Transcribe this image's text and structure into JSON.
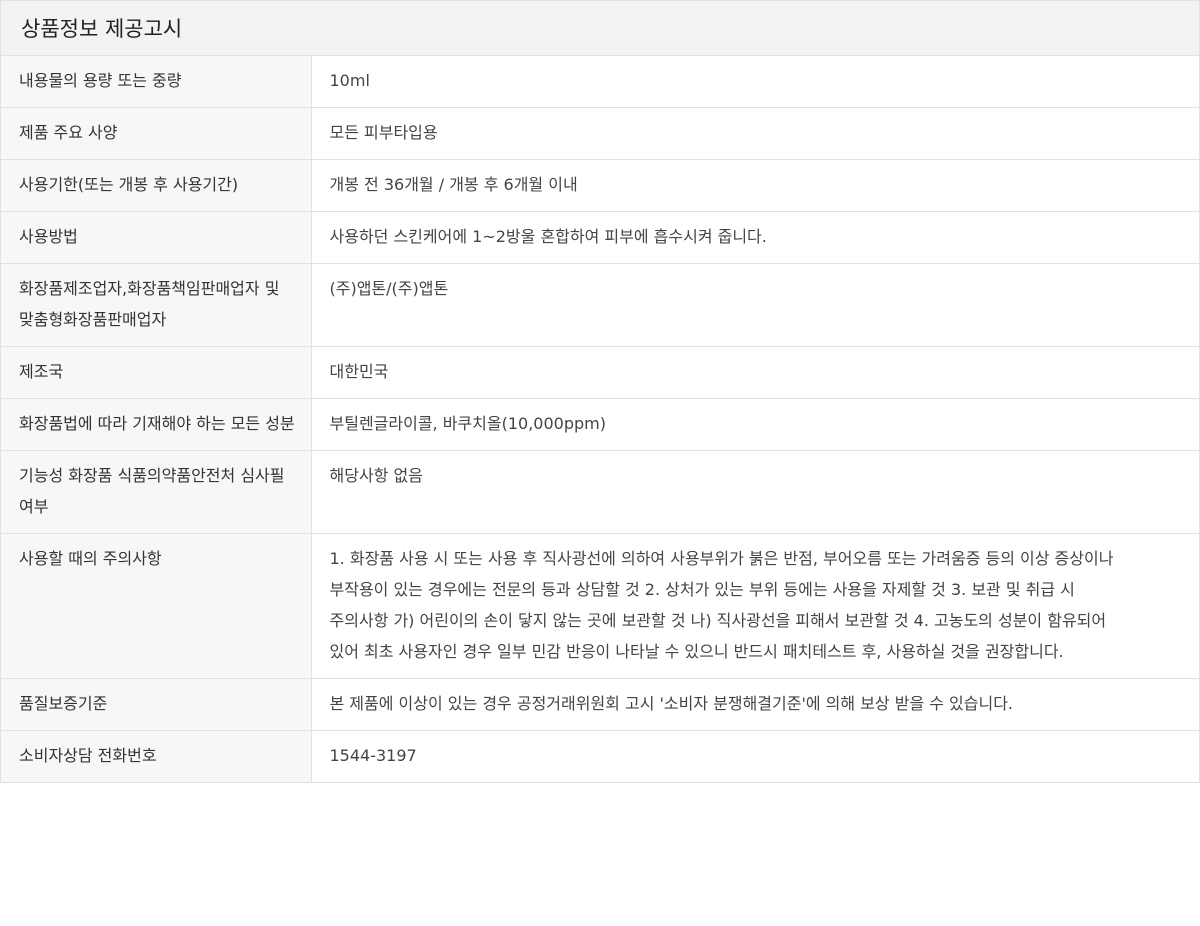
{
  "title": "상품정보 제공고시",
  "rows": [
    {
      "label": "내용물의 용량 또는 중량",
      "value": "10ml"
    },
    {
      "label": "제품 주요 사양",
      "value": "모든 피부타입용"
    },
    {
      "label": "사용기한(또는 개봉 후 사용기간)",
      "value": "개봉 전 36개월 / 개봉 후 6개월 이내"
    },
    {
      "label": "사용방법",
      "value": "사용하던 스킨케어에 1~2방울 혼합하여 피부에 흡수시켜 줍니다."
    },
    {
      "label": "화장품제조업자,화장품책임판매업자 및 맞춤형화장품판매업자",
      "value": "(주)앱톤/(주)앱톤"
    },
    {
      "label": "제조국",
      "value": "대한민국"
    },
    {
      "label": "화장품법에 따라 기재해야 하는 모든 성분",
      "value": "부틸렌글라이콜, 바쿠치올(10,000ppm)"
    },
    {
      "label": "기능성 화장품 식품의약품안전처 심사필 여부",
      "value": "해당사항 없음"
    },
    {
      "label": "사용할 때의 주의사항",
      "value": "1. 화장품 사용 시 또는 사용 후 직사광선에 의하여 사용부위가 붉은 반점, 부어오름 또는 가려움증 등의 이상 증상이나 부작용이 있는 경우에는 전문의 등과 상담할 것 2. 상처가 있는 부위 등에는 사용을 자제할 것 3. 보관 및 취급 시 주의사항 가) 어린이의 손이 닿지 않는 곳에 보관할 것 나) 직사광선을 피해서 보관할 것 4. 고농도의 성분이 함유되어 있어 최초 사용자인 경우 일부 민감 반응이 나타날 수 있으니 반드시 패치테스트 후, 사용하실 것을 권장합니다."
    },
    {
      "label": "품질보증기준",
      "value": "본 제품에 이상이 있는 경우 공정거래위원회 고시 '소비자 분쟁해결기준'에 의해 보상 받을 수 있습니다."
    },
    {
      "label": "소비자상담 전화번호",
      "value": "1544-3197"
    }
  ]
}
